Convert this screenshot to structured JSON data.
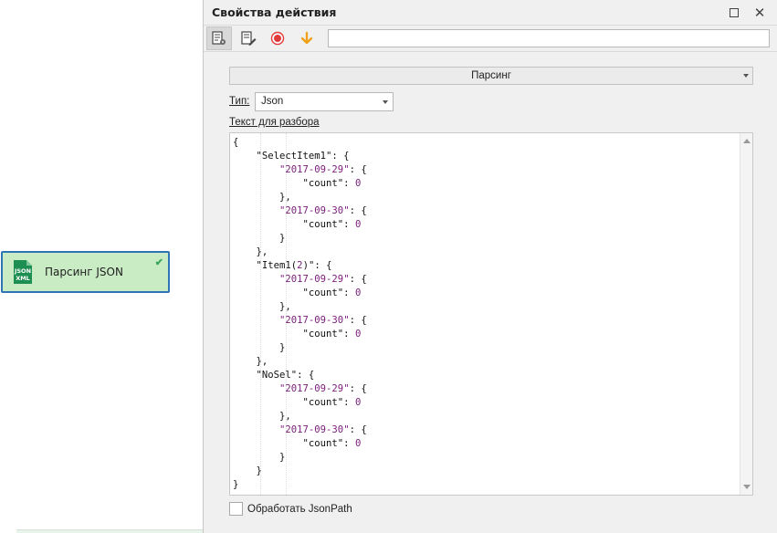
{
  "canvas": {
    "action": {
      "label": "Парсинг JSON",
      "icon": "json-xml-file-icon",
      "icon_text_top": "JSON",
      "icon_text_bottom": "XML",
      "status": "checkmark-icon",
      "fill_color": "#c9ecc4",
      "border_color": "#2f74b5"
    }
  },
  "panel": {
    "title": "Свойства действия",
    "toolbar": {
      "buttons": [
        "properties-settings-icon",
        "edit-properties-icon",
        "record-icon",
        "arrow-down-icon"
      ],
      "search_value": ""
    },
    "action_combo": "Парсинг",
    "type": {
      "label": "Тип:",
      "value": "Json"
    },
    "text_label": "Текст для разбора",
    "editor_lines": [
      "{",
      "    \"SelectItem1\": {",
      "        \"2017-09-29\": {",
      "            \"count\": 0",
      "        },",
      "        \"2017-09-30\": {",
      "            \"count\": 0",
      "        }",
      "    },",
      "    \"Item1(2)\": {",
      "        \"2017-09-29\": {",
      "            \"count\": 0",
      "        },",
      "        \"2017-09-30\": {",
      "            \"count\": 0",
      "        }",
      "    },",
      "    \"NoSel\": {",
      "        \"2017-09-29\": {",
      "            \"count\": 0",
      "        },",
      "        \"2017-09-30\": {",
      "            \"count\": 0",
      "        }",
      "    }",
      "}"
    ],
    "jsonpath_checkbox": {
      "label": "Обработать JsonPath",
      "checked": false
    }
  }
}
